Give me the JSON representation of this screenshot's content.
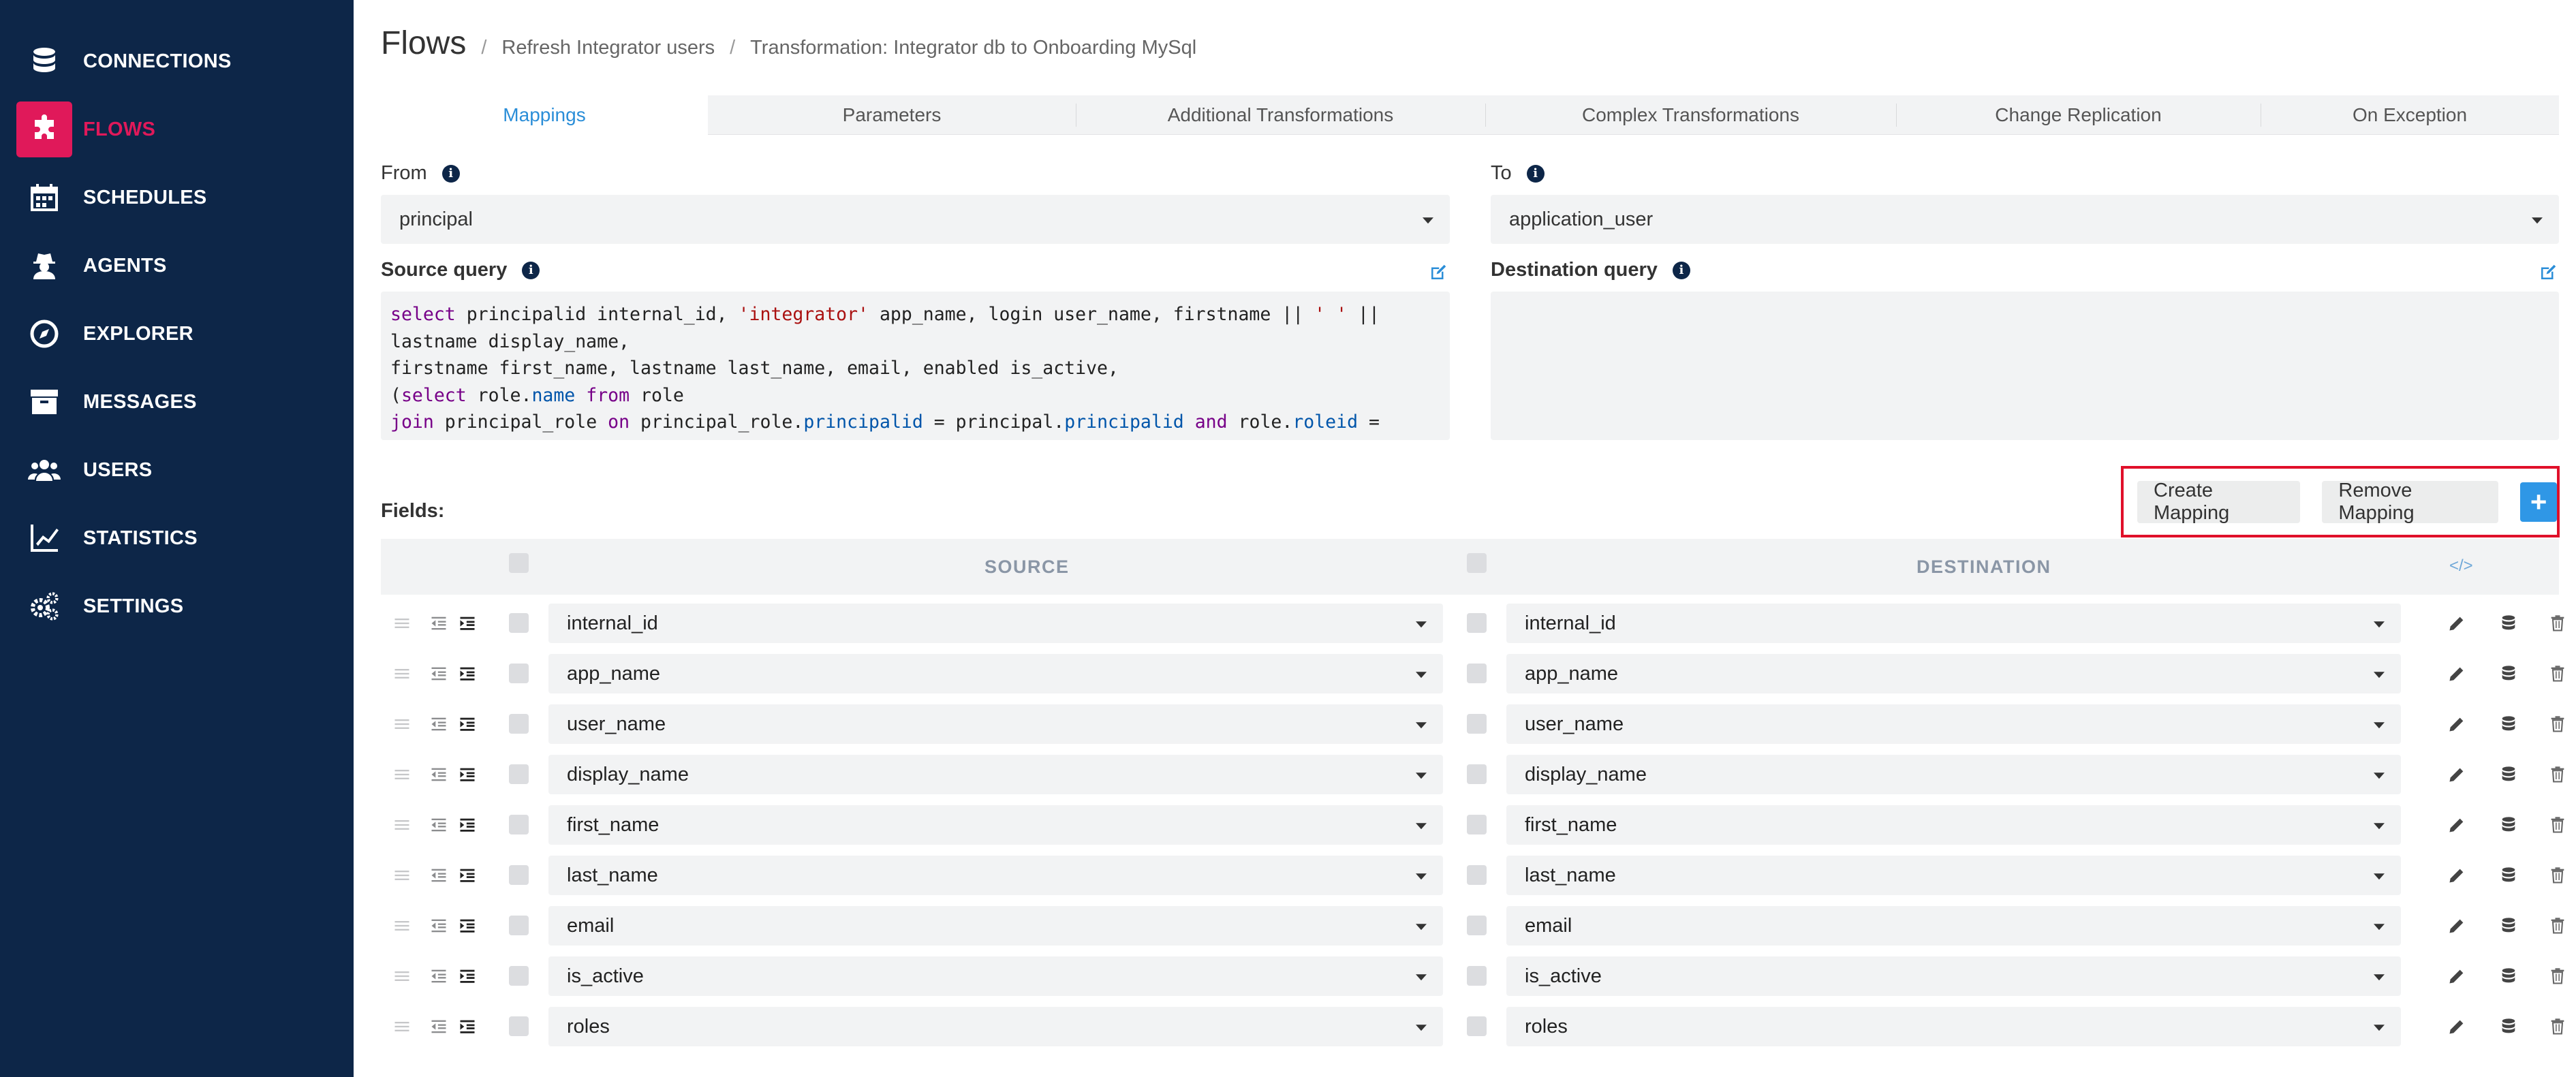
{
  "sidebar": {
    "items": [
      {
        "label": "CONNECTIONS",
        "icon": "database-icon",
        "active": false
      },
      {
        "label": "FLOWS",
        "icon": "puzzle-icon",
        "active": true
      },
      {
        "label": "SCHEDULES",
        "icon": "calendar-icon",
        "active": false
      },
      {
        "label": "AGENTS",
        "icon": "user-secret-icon",
        "active": false
      },
      {
        "label": "EXPLORER",
        "icon": "compass-icon",
        "active": false
      },
      {
        "label": "MESSAGES",
        "icon": "archive-icon",
        "active": false
      },
      {
        "label": "USERS",
        "icon": "users-icon",
        "active": false
      },
      {
        "label": "STATISTICS",
        "icon": "line-chart-icon",
        "active": false
      },
      {
        "label": "SETTINGS",
        "icon": "cogs-icon",
        "active": false
      }
    ],
    "active_color": "#e0195a",
    "background": "#0d2648"
  },
  "breadcrumb": {
    "title": "Flows",
    "items": [
      "Refresh Integrator users",
      "Transformation: Integrator db to Onboarding MySql"
    ]
  },
  "tabs": [
    {
      "label": "Mappings",
      "active": true
    },
    {
      "label": "Parameters",
      "active": false
    },
    {
      "label": "Additional Transformations",
      "active": false
    },
    {
      "label": "Complex Transformations",
      "active": false
    },
    {
      "label": "Change Replication",
      "active": false
    },
    {
      "label": "On Exception",
      "active": false
    }
  ],
  "from": {
    "label": "From",
    "value": "principal"
  },
  "to": {
    "label": "To",
    "value": "application_user"
  },
  "source_query": {
    "label": "Source query",
    "lines": [
      "select principalid internal_id, 'integrator' app_name, login user_name, firstname || ' ' ||",
      "lastname display_name,",
      "firstname first_name, lastname last_name, email, enabled is_active,",
      "(select role.name from role",
      "join principal_role on principal_role.principalid = principal.principalid and role.roleid ="
    ]
  },
  "destination_query": {
    "label": "Destination query",
    "value": ""
  },
  "fields_label": "Fields:",
  "actions": {
    "create_mapping": "Create Mapping",
    "remove_mapping": "Remove Mapping",
    "add": "+"
  },
  "table": {
    "source_header": "SOURCE",
    "destination_header": "DESTINATION",
    "code_header_icon": "</>",
    "rows": [
      {
        "source": "internal_id",
        "destination": "internal_id"
      },
      {
        "source": "app_name",
        "destination": "app_name"
      },
      {
        "source": "user_name",
        "destination": "user_name"
      },
      {
        "source": "display_name",
        "destination": "display_name"
      },
      {
        "source": "first_name",
        "destination": "first_name"
      },
      {
        "source": "last_name",
        "destination": "last_name"
      },
      {
        "source": "email",
        "destination": "email"
      },
      {
        "source": "is_active",
        "destination": "is_active"
      },
      {
        "source": "roles",
        "destination": "roles"
      }
    ]
  },
  "colors": {
    "accent_blue": "#2b8ed8",
    "plus_button": "#2f97e6",
    "highlight_frame": "#e0102a"
  }
}
